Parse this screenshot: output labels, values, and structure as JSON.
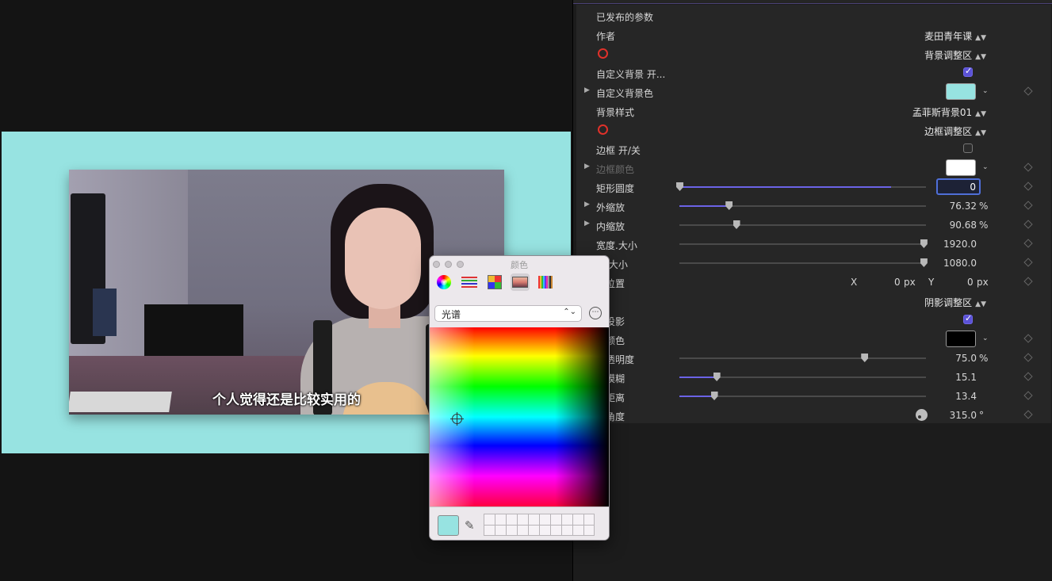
{
  "viewer": {
    "background_color": "#97e3e1",
    "subtitle": "个人觉得还是比较实用的"
  },
  "inspector": {
    "section_title": "已发布的参数",
    "rows": {
      "author": {
        "label": "作者",
        "value": "麦田青年课"
      },
      "bg_zone": {
        "value": "背景调整区"
      },
      "custom_bg_toggle": {
        "label": "自定义背景 开...",
        "checked": true
      },
      "custom_bg_color": {
        "label": "自定义背景色",
        "color": "#97e3e1"
      },
      "bg_style": {
        "label": "背景样式",
        "value": "孟菲斯背景01"
      },
      "border_zone": {
        "value": "边框调整区"
      },
      "border_toggle": {
        "label": "边框 开/关",
        "checked": false
      },
      "border_color": {
        "label": "边框颜色",
        "color": "#ffffff"
      },
      "corner": {
        "label": "矩形圆度",
        "value": "0",
        "fill_pct": 86
      },
      "outer_scale": {
        "label": "外缩放",
        "value": "76.32",
        "unit": "%",
        "fill_pct": 20
      },
      "inner_scale": {
        "label": "内缩放",
        "value": "90.68",
        "unit": "%",
        "fill_pct": 23
      },
      "width": {
        "label": "宽度.大小",
        "value": "1920.0",
        "fill_pct": 99
      },
      "height": {
        "label": "度.大小",
        "value": "1080.0",
        "fill_pct": 99
      },
      "position": {
        "label": "框位置",
        "x_label": "X",
        "x_value": "0",
        "x_unit": "px",
        "y_label": "Y",
        "y_value": "0",
        "y_unit": "px"
      },
      "shadow_zone": {
        "value": "阴影调整区"
      },
      "shadow_toggle": {
        "label": "框投影",
        "checked": true
      },
      "shadow_color": {
        "label": "影颜色",
        "color": "#000000"
      },
      "shadow_opacity": {
        "label": "影透明度",
        "value": "75.0",
        "unit": "%",
        "fill_pct": 75
      },
      "shadow_blur": {
        "label": "影模糊",
        "value": "15.1",
        "fill_pct": 15
      },
      "shadow_distance": {
        "label": "影距离",
        "value": "13.4",
        "fill_pct": 14
      },
      "shadow_angle": {
        "label": "影角度",
        "value": "315.0",
        "unit": "°"
      }
    }
  },
  "color_picker": {
    "title": "颜色",
    "tools": [
      "color-wheel-icon",
      "sliders-icon",
      "palette-icon",
      "image-palette-icon",
      "pencils-icon"
    ],
    "mode": "光谱",
    "more_label": "⋯",
    "current_color": "#97e3e1"
  }
}
